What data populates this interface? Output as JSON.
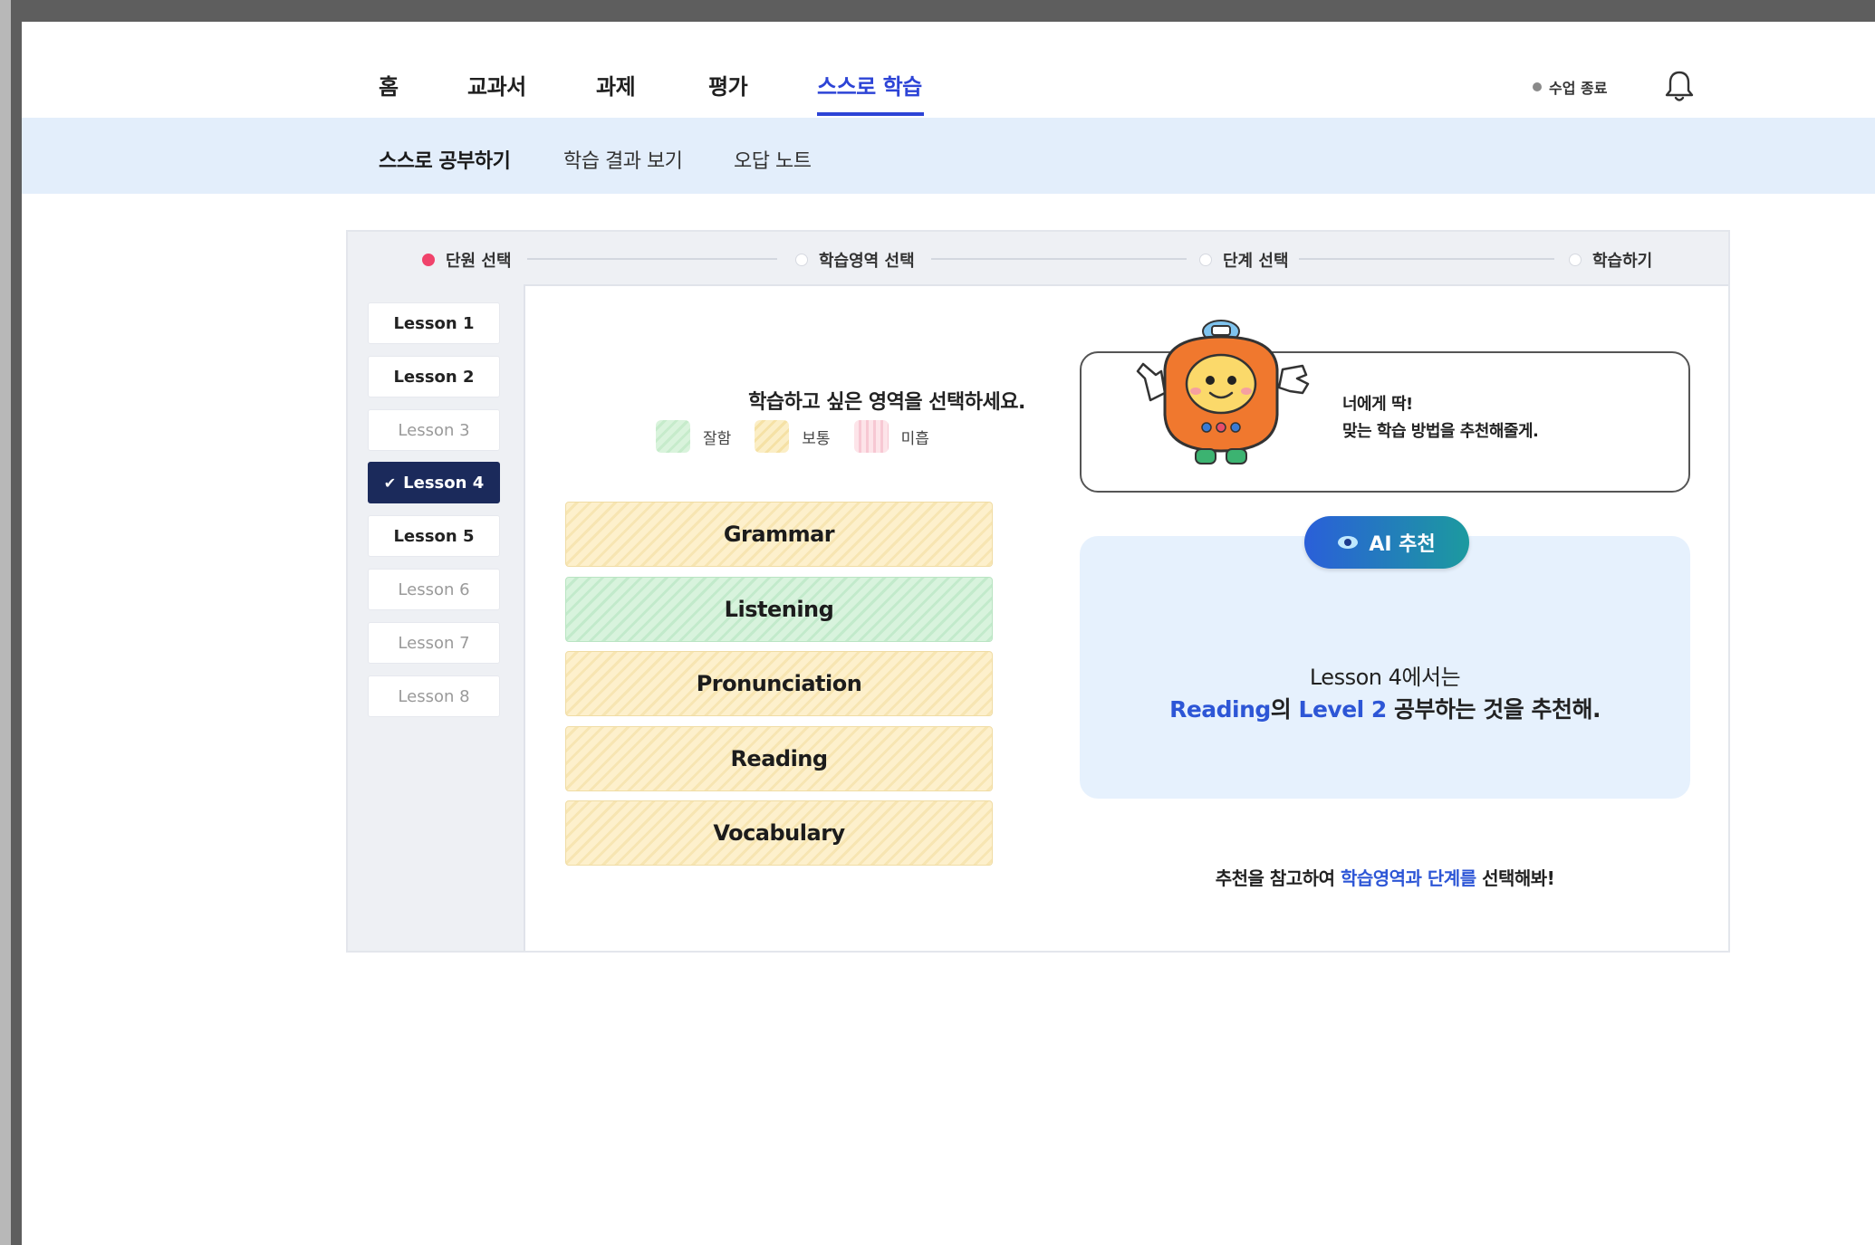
{
  "nav": {
    "items": [
      {
        "label": "홈"
      },
      {
        "label": "교과서"
      },
      {
        "label": "과제"
      },
      {
        "label": "평가"
      },
      {
        "label": "스스로 학습"
      }
    ],
    "end_class": "수업 종료"
  },
  "subnav": {
    "items": [
      {
        "label": "스스로 공부하기"
      },
      {
        "label": "학습 결과 보기"
      },
      {
        "label": "오답 노트"
      }
    ]
  },
  "stepper": {
    "steps": [
      {
        "label": "단원 선택"
      },
      {
        "label": "학습영역 선택"
      },
      {
        "label": "단계 선택"
      },
      {
        "label": "학습하기"
      }
    ]
  },
  "lessons": [
    {
      "label": "Lesson 1"
    },
    {
      "label": "Lesson 2"
    },
    {
      "label": "Lesson 3"
    },
    {
      "label": "Lesson 4",
      "check": "✔"
    },
    {
      "label": "Lesson 5"
    },
    {
      "label": "Lesson 6"
    },
    {
      "label": "Lesson 7"
    },
    {
      "label": "Lesson 8"
    }
  ],
  "areas": {
    "prompt": "학습하고 싶은 영역을 선택하세요.",
    "legend": {
      "good": "잘함",
      "mid": "보통",
      "low": "미흡"
    },
    "items": [
      {
        "label": "Grammar"
      },
      {
        "label": "Listening"
      },
      {
        "label": "Pronunciation"
      },
      {
        "label": "Reading"
      },
      {
        "label": "Vocabulary"
      }
    ]
  },
  "recommend": {
    "bubble_line1": "너에게 딱!",
    "bubble_line2": "맞는 학습 방법을 추천해줄게.",
    "badge": "AI 추천",
    "line1": "Lesson 4에서는",
    "area": "Reading",
    "particle": "의 ",
    "level": "Level 2",
    "line2_rest": " 공부하는 것을 추천해.",
    "hint_prefix": "추천을 참고하여 ",
    "hint_highlight": "학습영역과 단계를",
    "hint_suffix": " 선택해봐!"
  },
  "colors": {
    "accent": "#2d44d6",
    "step_active": "#f0436b",
    "lesson_selected": "#1b2a5b",
    "subnav_bg": "#e3eefb",
    "ai_panel_bg": "#e6f1fd"
  }
}
